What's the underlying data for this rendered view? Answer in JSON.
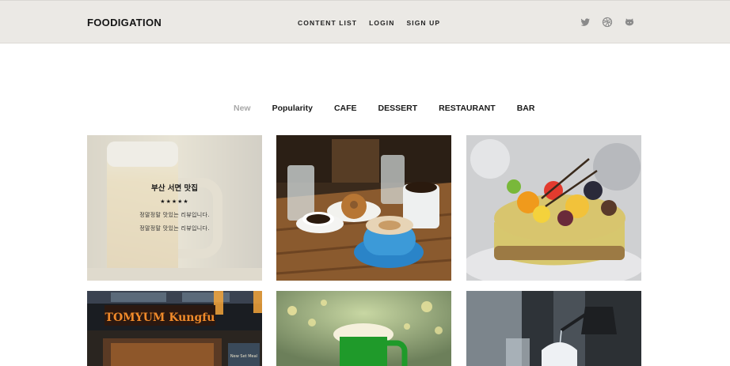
{
  "header": {
    "logo": "FOODIGATION",
    "nav": [
      "CONTENT LIST",
      "LOGIN",
      "SIGN UP"
    ],
    "social_icons": [
      "twitter-icon",
      "dribbble-icon",
      "github-icon"
    ]
  },
  "filters": {
    "items": [
      "New",
      "Popularity",
      "CAFE",
      "DESSERT",
      "RESTAURANT",
      "BAR"
    ],
    "active": "New"
  },
  "featured_card": {
    "title": "부산 서면 맛집",
    "stars": "★★★★★",
    "desc_line1": "정말정말 맛있는 리뷰입니다.",
    "desc_line2": "정말정말 맛있는 리뷰입니다."
  },
  "cards": [
    {
      "name": "beer-card",
      "image": "beer mug photo"
    },
    {
      "name": "coffee-card",
      "image": "coffee and donut photo"
    },
    {
      "name": "cake-card",
      "image": "fruit cheesecake photo"
    },
    {
      "name": "restaurant-card",
      "image": "storefront sign photo",
      "sign_text": "TOMYUM Kungfu"
    },
    {
      "name": "green-beer-card",
      "image": "green beer mug photo"
    },
    {
      "name": "pour-over-card",
      "image": "coffee pour over photo"
    }
  ],
  "colors": {
    "header_bg": "#ebe9e5",
    "filter_inactive": "#a8a8a8",
    "text": "#151515"
  }
}
